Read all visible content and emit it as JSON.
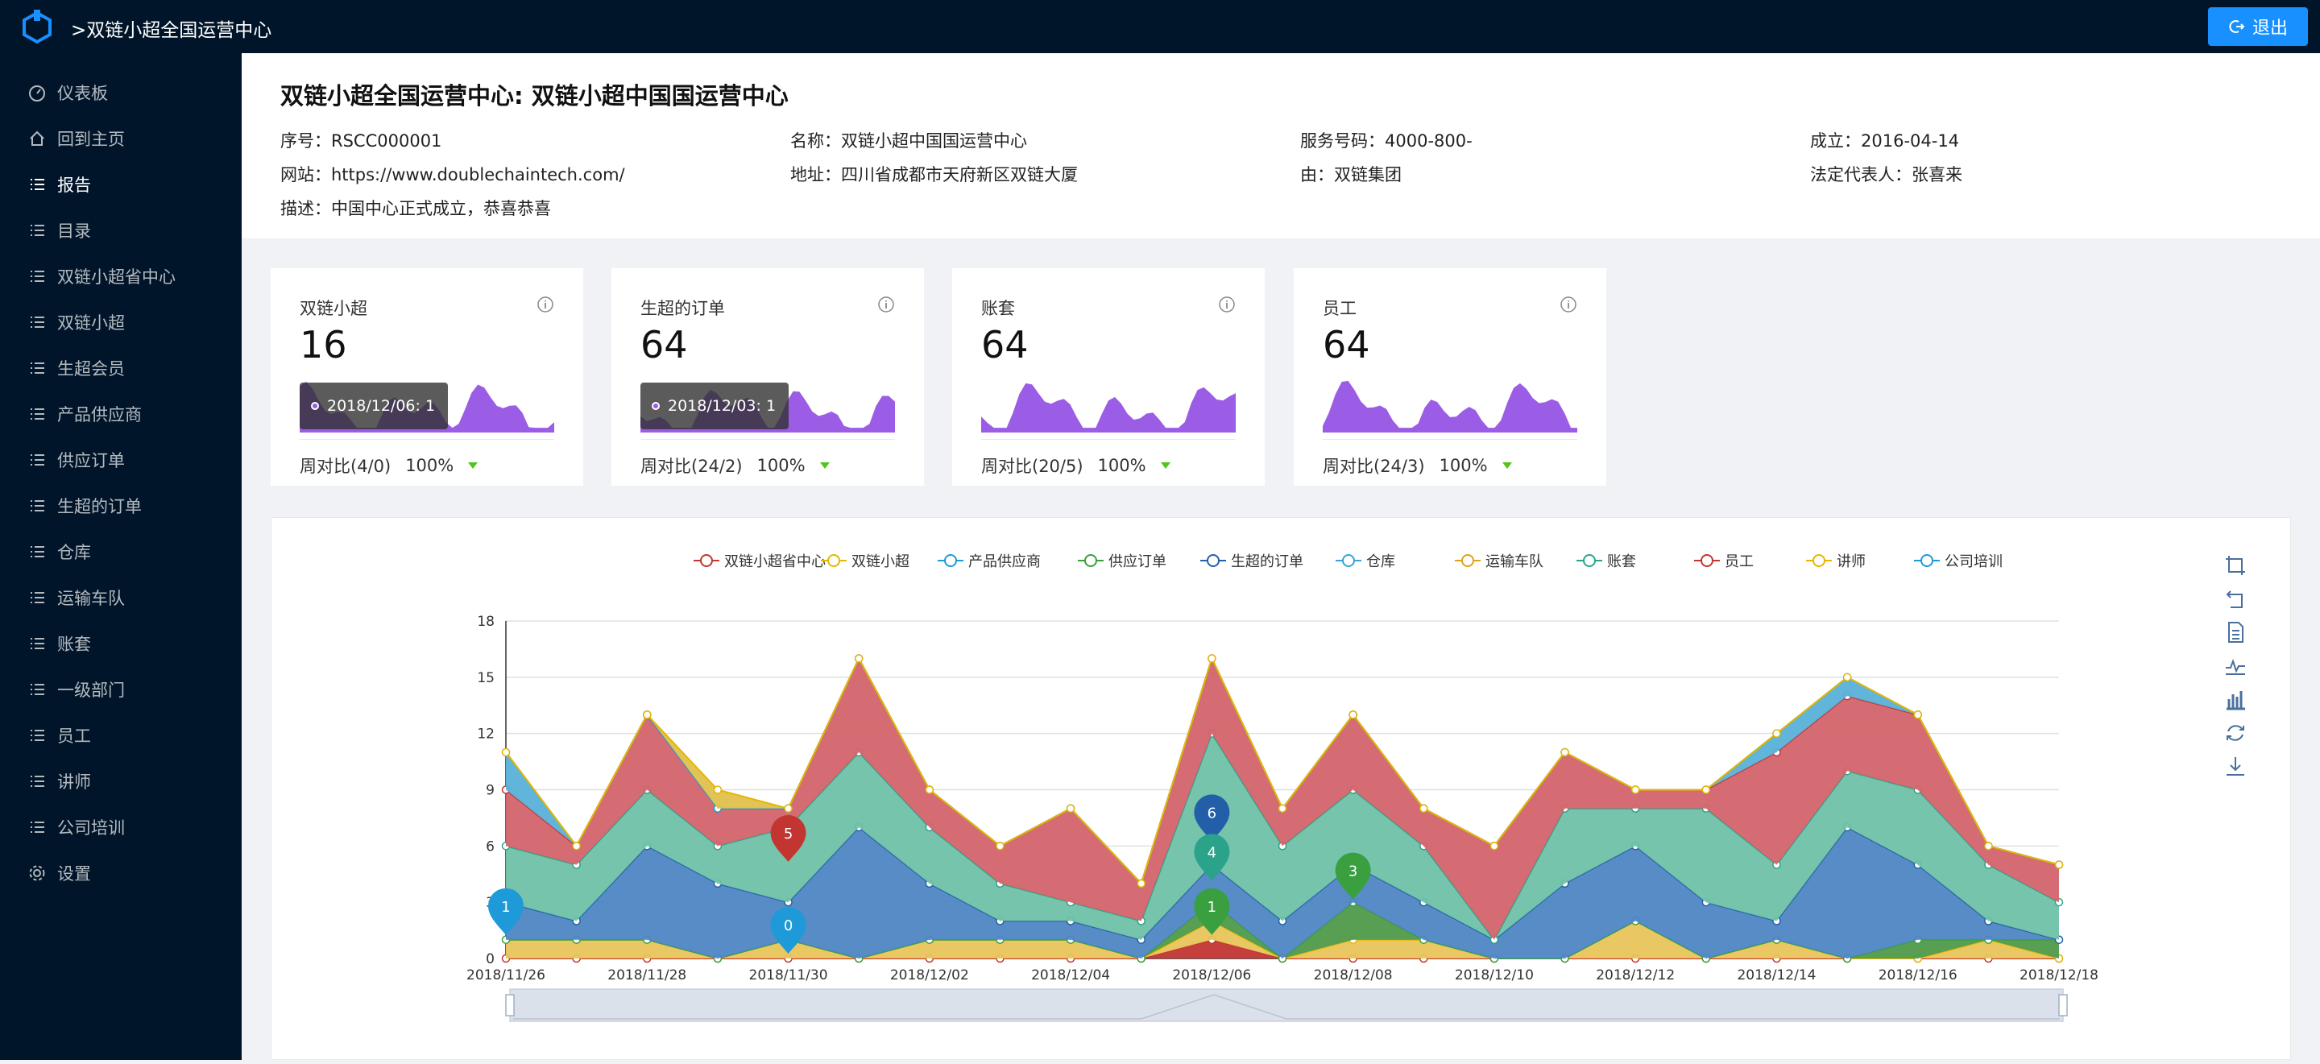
{
  "app": {
    "title": ">双链小超全国运营中心",
    "logout": "退出"
  },
  "sidebar": {
    "items": [
      {
        "label": "仪表板",
        "icon": "dashboard-icon"
      },
      {
        "label": "回到主页",
        "icon": "home-icon"
      },
      {
        "label": "报告",
        "icon": "list-icon",
        "active": true
      },
      {
        "label": "目录",
        "icon": "list-icon"
      },
      {
        "label": "双链小超省中心",
        "icon": "list-icon"
      },
      {
        "label": "双链小超",
        "icon": "list-icon"
      },
      {
        "label": "生超会员",
        "icon": "list-icon"
      },
      {
        "label": "产品供应商",
        "icon": "list-icon"
      },
      {
        "label": "供应订单",
        "icon": "list-icon"
      },
      {
        "label": "生超的订单",
        "icon": "list-icon"
      },
      {
        "label": "仓库",
        "icon": "list-icon"
      },
      {
        "label": "运输车队",
        "icon": "list-icon"
      },
      {
        "label": "账套",
        "icon": "list-icon"
      },
      {
        "label": "一级部门",
        "icon": "list-icon"
      },
      {
        "label": "员工",
        "icon": "list-icon"
      },
      {
        "label": "讲师",
        "icon": "list-icon"
      },
      {
        "label": "公司培训",
        "icon": "list-icon"
      },
      {
        "label": "设置",
        "icon": "gear-icon"
      }
    ]
  },
  "header": {
    "title": "双链小超全国运营中心: 双链小超中国国运营中心",
    "fields": [
      "序号：RSCC000001",
      "名称：双链小超中国国运营中心",
      "服务号码：4000-800-",
      "成立：2016-04-14",
      "网站：https://www.doublechaintech.com/",
      "地址：四川省成都市天府新区双链大厦",
      "由：双链集团",
      "法定代表人：张喜来",
      "描述：中国中心正式成立，恭喜恭喜"
    ]
  },
  "cards": [
    {
      "title": "双链小超",
      "value": "16",
      "footer": "周对比(4/0)",
      "percent": "100%",
      "tooltip": "2018/12/06: 1"
    },
    {
      "title": "生超的订单",
      "value": "64",
      "footer": "周对比(24/2)",
      "percent": "100%",
      "tooltip": "2018/12/03: 1"
    },
    {
      "title": "账套",
      "value": "64",
      "footer": "周对比(20/5)",
      "percent": "100%",
      "tooltip": ""
    },
    {
      "title": "员工",
      "value": "64",
      "footer": "周对比(24/3)",
      "percent": "100%",
      "tooltip": ""
    }
  ],
  "colors": {
    "sidebar": "#001529",
    "accent": "#1890ff",
    "spark": "#9b5de5"
  },
  "chart_data": {
    "type": "area",
    "stacked": true,
    "x": [
      "2018/11/26",
      "2018/11/27",
      "2018/11/28",
      "2018/11/29",
      "2018/11/30",
      "2018/12/01",
      "2018/12/02",
      "2018/12/03",
      "2018/12/04",
      "2018/12/05",
      "2018/12/06",
      "2018/12/07",
      "2018/12/08",
      "2018/12/09",
      "2018/12/10",
      "2018/12/11",
      "2018/12/12",
      "2018/12/13",
      "2018/12/14",
      "2018/12/15",
      "2018/12/16",
      "2018/12/17",
      "2018/12/18"
    ],
    "xticks": [
      "2018/11/26",
      "2018/11/28",
      "2018/11/30",
      "2018/12/02",
      "2018/12/04",
      "2018/12/06",
      "2018/12/08",
      "2018/12/10",
      "2018/12/12",
      "2018/12/14",
      "2018/12/16",
      "2018/12/18"
    ],
    "yticks": [
      0,
      3,
      6,
      9,
      12,
      15,
      18
    ],
    "ylim": [
      0,
      18
    ],
    "legend": [
      "双链小超省中心",
      "双链小超",
      "产品供应商",
      "供应订单",
      "生超的订单",
      "仓库",
      "运输车队",
      "账套",
      "员工",
      "讲师",
      "公司培训"
    ],
    "legend_colors": [
      "#c23531",
      "#e6b600",
      "#1f9ad8",
      "#3a9f3f",
      "#225fa8",
      "#36a3d9",
      "#e0a21b",
      "#2aa38a",
      "#c23531",
      "#e6b600",
      "#1f9ad8"
    ],
    "series": [
      {
        "name": "双链小超省中心",
        "values": [
          0,
          0,
          0,
          0,
          0,
          0,
          0,
          0,
          0,
          0,
          1,
          0,
          0,
          0,
          0,
          0,
          0,
          0,
          0,
          0,
          0,
          0,
          0
        ]
      },
      {
        "name": "双链小超",
        "values": [
          1,
          1,
          1,
          0,
          1,
          0,
          1,
          1,
          1,
          0,
          1,
          0,
          1,
          1,
          0,
          0,
          2,
          0,
          1,
          0,
          0,
          1,
          0
        ]
      },
      {
        "name": "供应订单",
        "values": [
          0,
          0,
          0,
          0,
          0,
          0,
          0,
          0,
          0,
          0,
          1,
          0,
          2,
          0,
          0,
          0,
          0,
          0,
          0,
          0,
          1,
          0,
          1
        ]
      },
      {
        "name": "生超的订单",
        "values": [
          2,
          1,
          5,
          4,
          2,
          7,
          3,
          1,
          1,
          1,
          2,
          2,
          2,
          2,
          1,
          4,
          4,
          3,
          1,
          7,
          4,
          1,
          0
        ]
      },
      {
        "name": "账套",
        "values": [
          3,
          3,
          3,
          2,
          4,
          4,
          3,
          2,
          1,
          1,
          7,
          4,
          4,
          3,
          0,
          4,
          2,
          5,
          3,
          3,
          4,
          3,
          2
        ]
      },
      {
        "name": "员工",
        "values": [
          3,
          1,
          4,
          2,
          1,
          5,
          2,
          2,
          5,
          2,
          4,
          2,
          4,
          2,
          5,
          3,
          1,
          1,
          6,
          4,
          4,
          1,
          2
        ]
      },
      {
        "name": "公司培训",
        "values": [
          2,
          0,
          0,
          0,
          0,
          0,
          0,
          0,
          0,
          0,
          0,
          0,
          0,
          0,
          0,
          0,
          0,
          0,
          1,
          1,
          0,
          0,
          0
        ]
      },
      {
        "name": "讲师",
        "values": [
          0,
          0,
          0,
          1,
          0,
          0,
          0,
          0,
          0,
          0,
          0,
          0,
          0,
          0,
          0,
          0,
          0,
          0,
          0,
          0,
          0,
          0,
          0
        ]
      }
    ],
    "markers": [
      {
        "x": "2018/11/26",
        "label": "1",
        "color": "#1f9ad8",
        "value": 2.8
      },
      {
        "x": "2018/11/30",
        "label": "5",
        "color": "#c23531",
        "value": 6.7
      },
      {
        "x": "2018/11/30",
        "label": "0",
        "color": "#1f9ad8",
        "value": 1.8
      },
      {
        "x": "2018/12/06",
        "label": "6",
        "color": "#225fa8",
        "value": 7.8
      },
      {
        "x": "2018/12/06",
        "label": "4",
        "color": "#2aa38a",
        "value": 5.7
      },
      {
        "x": "2018/12/06",
        "label": "1",
        "color": "#3a9f3f",
        "value": 2.8
      },
      {
        "x": "2018/12/08",
        "label": "3",
        "color": "#3a9f3f",
        "value": 4.7
      }
    ]
  }
}
